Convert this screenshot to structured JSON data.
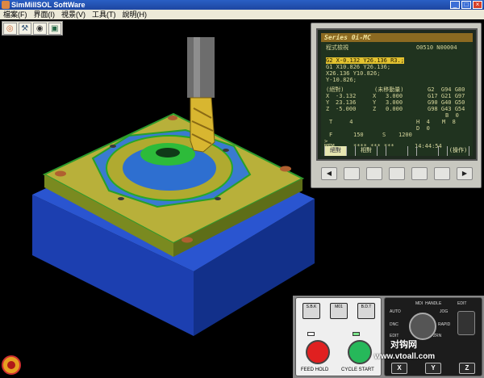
{
  "window": {
    "title": "SimMillSOL SoftWare"
  },
  "menu": [
    "檔案(F)",
    "界面(I)",
    "視景(V)",
    "工具(T)",
    "說明(H)"
  ],
  "toolbar": {
    "icons": [
      "disc-icon",
      "tools-icon",
      "eye-icon",
      "machine-icon"
    ]
  },
  "cnc": {
    "header": "Series 0i-MC",
    "screen_title": "程式檢視",
    "program": "O0510 N00004",
    "lines": [
      {
        "text": "G2 X-0.132 Y26.136 R3.;",
        "highlight": true
      },
      {
        "text": "G1 X10.826 Y26.136;",
        "highlight": false
      },
      {
        "text": "X26.136 Y10.826;",
        "highlight": false
      },
      {
        "text": "Y-10.826;",
        "highlight": false
      }
    ],
    "coords_headers": {
      "abs": "(絕對)",
      "remain": "(未移動量)"
    },
    "axes": [
      {
        "axis": "X",
        "abs": "-3.132",
        "raxis": "X",
        "remain": "3.000",
        "g": "G17 G21 G97"
      },
      {
        "axis": "Y",
        "abs": "23.136",
        "raxis": "Y",
        "remain": "3.000",
        "g": "G90 G40 G50"
      },
      {
        "axis": "Z",
        "abs": "-5.000",
        "raxis": "Z",
        "remain": "0.000",
        "g": "G98 G43 G54"
      }
    ],
    "gcodes_top": "G2  G94 G80",
    "b_value": "B  0",
    "h_value": "H  4",
    "m_value": "M  8",
    "t_value": "T     4",
    "d_value": "D  0",
    "f_label": "F",
    "f_value": "150",
    "s_label": "S",
    "s_value": "1200",
    "mode": "MEM",
    "status_stars": "**** *** ***",
    "time": "14:44:54",
    "prompt": ">_",
    "softkeys": [
      "絕對",
      "相對",
      "",
      "",
      "(操作)"
    ],
    "hw_keys": [
      "◀",
      "",
      "",
      "",
      "",
      "",
      "▶"
    ]
  },
  "operator": {
    "sbk": "S.B.K",
    "m01": "M01",
    "bdt": "B.D.T",
    "feed_hold": "FEED HOLD",
    "cycle_start": "CYCLE START",
    "mode_labels": {
      "mdi": "MDI",
      "handle": "HANDLE",
      "edit": "EDIT",
      "auto": "AUTO",
      "jog": "JOG",
      "rapid": "RAPID",
      "dnc": "DNC",
      "zrn": "ZRN",
      "edit2": "EDIT"
    },
    "axis_buttons": [
      "X",
      "Y",
      "Z"
    ]
  },
  "watermark": {
    "brand": "对钩网",
    "url": "www.vtoall.com"
  }
}
